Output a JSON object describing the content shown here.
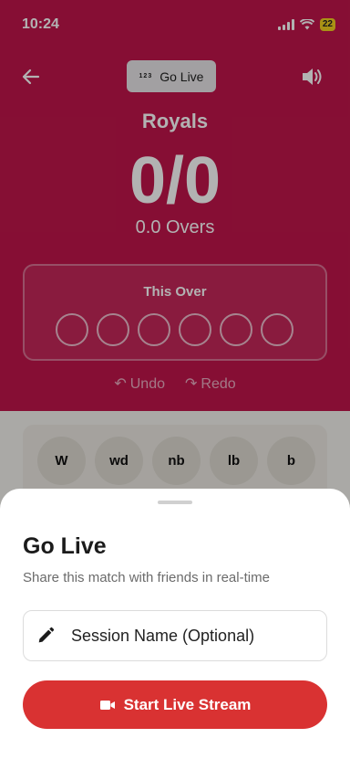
{
  "status_bar": {
    "time": "10:24",
    "battery": "22"
  },
  "header": {
    "go_live_tag": "123",
    "go_live_label": "Go Live"
  },
  "scoreboard": {
    "team": "Royals",
    "score": "0/0",
    "overs": "0.0 Overs"
  },
  "this_over": {
    "title": "This Over",
    "ball_count": 6
  },
  "actions": {
    "undo": "Undo",
    "redo": "Redo"
  },
  "extras": [
    "W",
    "wd",
    "nb",
    "lb",
    "b"
  ],
  "sheet": {
    "title": "Go Live",
    "subtitle": "Share this match with friends in real-time",
    "session_label": "Session Name (Optional)",
    "start_button": "Start Live Stream"
  },
  "colors": {
    "primary": "#c0154b",
    "cta": "#d93232",
    "battery": "#f2d21f"
  }
}
